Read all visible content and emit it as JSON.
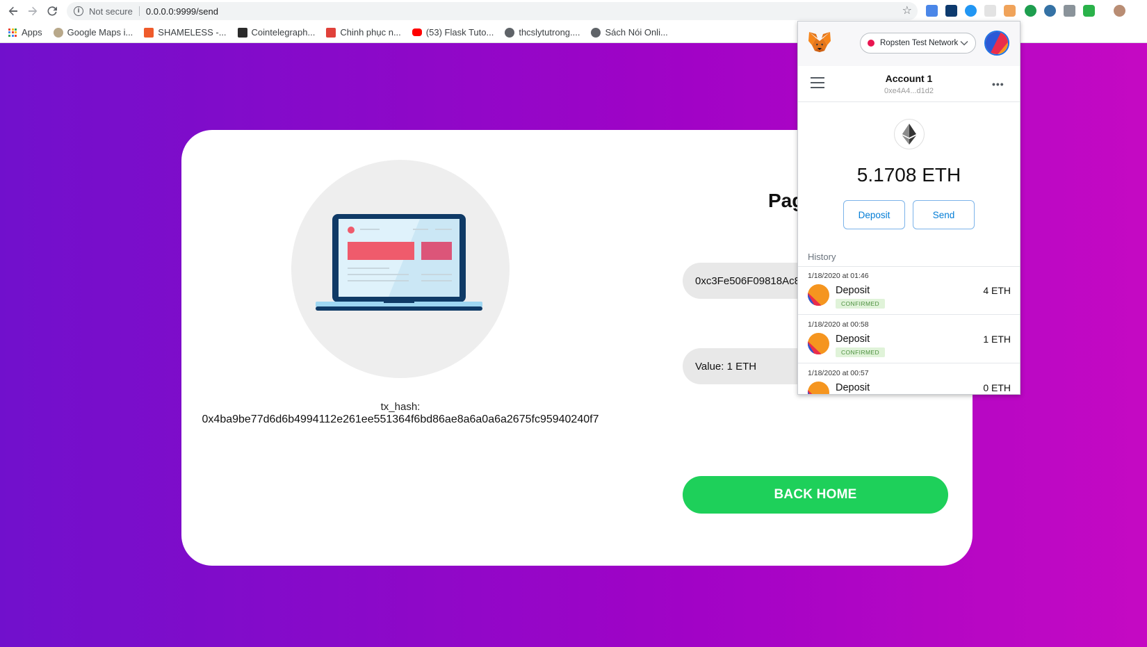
{
  "browser": {
    "security_label": "Not secure",
    "url": "0.0.0.0:9999/send"
  },
  "bookmarks": [
    {
      "label": "Apps",
      "icon": "apps-grid-icon"
    },
    {
      "label": "Google Maps i...",
      "icon": "google-maps-icon"
    },
    {
      "label": "SHAMELESS -...",
      "icon": "shameless-icon"
    },
    {
      "label": "Cointelegraph...",
      "icon": "cointelegraph-icon"
    },
    {
      "label": "Chinh phục n...",
      "icon": "pdf-icon"
    },
    {
      "label": "(53) Flask Tuto...",
      "icon": "youtube-icon"
    },
    {
      "label": "thcslytutrong....",
      "icon": "globe-icon"
    },
    {
      "label": "Sách Nói Onli...",
      "icon": "globe-icon"
    }
  ],
  "page": {
    "title": "Pag",
    "tx_hash_label": "tx_hash:",
    "tx_hash": "0x4ba9be77d6d6b4994112e261ee551364f6bd86ae8a6a0a6a2675fc95940240f7",
    "address_value": "0xc3Fe506F09818Ac8A",
    "value_text": "Value: 1 ETH",
    "back_button": "BACK HOME"
  },
  "metamask": {
    "network": "Ropsten Test Network",
    "account_name": "Account 1",
    "account_address": "0xe4A4...d1d2",
    "balance": "5.1708 ETH",
    "deposit_button": "Deposit",
    "send_button": "Send",
    "history_label": "History",
    "transactions": [
      {
        "date": "1/18/2020 at 01:46",
        "type": "Deposit",
        "status": "CONFIRMED",
        "amount": "4 ETH"
      },
      {
        "date": "1/18/2020 at 00:58",
        "type": "Deposit",
        "status": "CONFIRMED",
        "amount": "1 ETH"
      },
      {
        "date": "1/18/2020 at 00:57",
        "type": "Deposit",
        "status": "",
        "amount": "0 ETH"
      }
    ]
  },
  "colors": {
    "gradient_start": "#7110cc",
    "gradient_end": "#c509c3",
    "back_button": "#1ed05a",
    "metamask_link": "#037dd6",
    "ropsten_dot": "#e91550"
  }
}
